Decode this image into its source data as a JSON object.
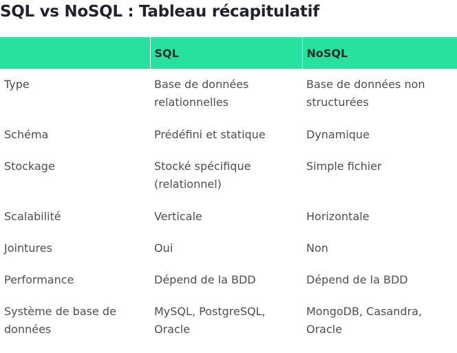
{
  "title": "SQL vs NoSQL : Tableau récapitulatif",
  "table": {
    "headers": [
      "",
      "SQL",
      "NoSQL"
    ],
    "header_color": "#27e29e",
    "rows": [
      [
        "Type",
        "Base de données relationnelles",
        "Base de données non structurées"
      ],
      [
        "Schéma",
        "Prédéfini et statique",
        "Dynamique"
      ],
      [
        "Stockage",
        "Stocké spécifique (relationnel)",
        "Simple fichier"
      ],
      [
        "Scalabilité",
        "Verticale",
        "Horizontale"
      ],
      [
        "Jointures",
        "Oui",
        "Non"
      ],
      [
        "Performance",
        "Dépend de la BDD",
        "Dépend de la BDD"
      ],
      [
        "Système de base de données",
        "MySQL, PostgreSQL, Oracle",
        "MongoDB, Casandra, Oracle"
      ]
    ]
  }
}
